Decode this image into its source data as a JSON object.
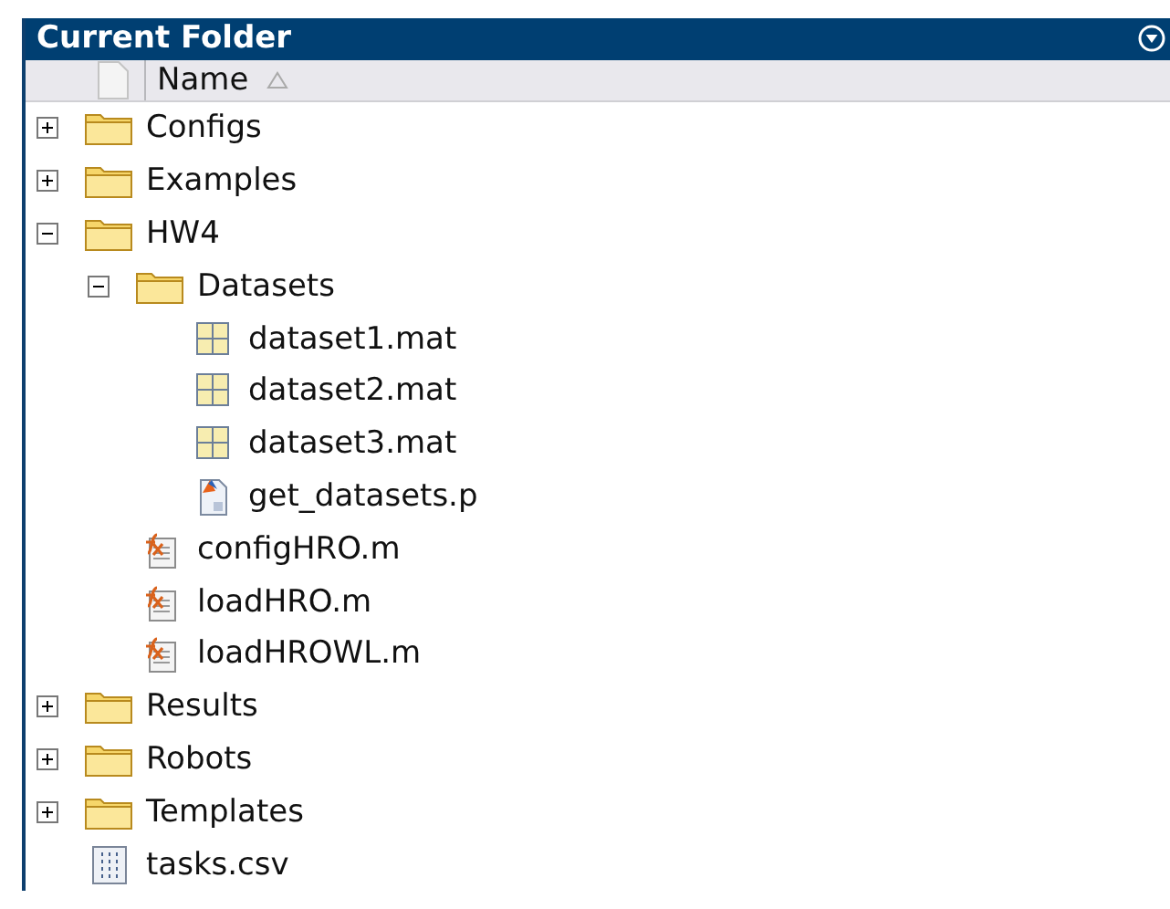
{
  "panel": {
    "title": "Current Folder"
  },
  "header": {
    "column": "Name"
  },
  "tree": [
    {
      "name": "Configs",
      "kind": "folder",
      "expanded": false
    },
    {
      "name": "Examples",
      "kind": "folder",
      "expanded": false
    },
    {
      "name": "HW4",
      "kind": "folder",
      "expanded": true,
      "children": [
        {
          "name": "Datasets",
          "kind": "folder",
          "expanded": true,
          "children": [
            {
              "name": "dataset1.mat",
              "kind": "mat"
            },
            {
              "name": "dataset2.mat",
              "kind": "mat"
            },
            {
              "name": "dataset3.mat",
              "kind": "mat"
            },
            {
              "name": "get_datasets.p",
              "kind": "pcode"
            }
          ]
        },
        {
          "name": "configHRO.m",
          "kind": "mfile"
        },
        {
          "name": "loadHRO.m",
          "kind": "mfile"
        },
        {
          "name": "loadHROWL.m",
          "kind": "mfile"
        }
      ]
    },
    {
      "name": "Results",
      "kind": "folder",
      "expanded": false
    },
    {
      "name": "Robots",
      "kind": "folder",
      "expanded": false
    },
    {
      "name": "Templates",
      "kind": "folder",
      "expanded": false
    },
    {
      "name": "tasks.csv",
      "kind": "csv"
    }
  ]
}
